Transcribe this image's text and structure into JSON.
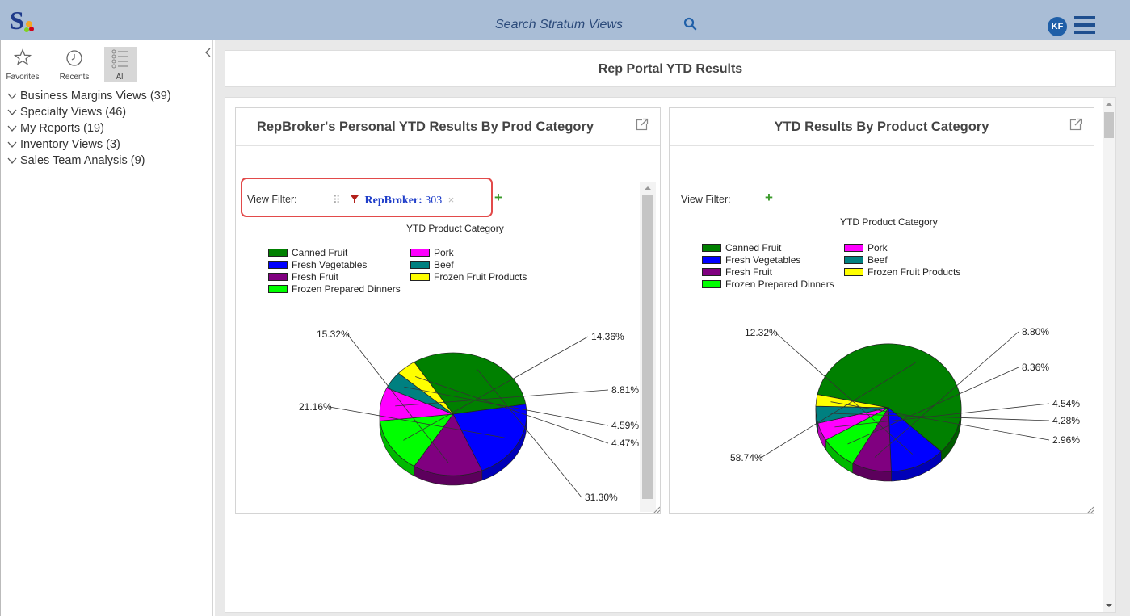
{
  "search": {
    "placeholder": "Search Stratum Views"
  },
  "user": {
    "initials": "KF"
  },
  "sidebar": {
    "nav": [
      {
        "label": "Favorites",
        "icon": "star-icon"
      },
      {
        "label": "Recents",
        "icon": "clock-icon"
      },
      {
        "label": "All",
        "icon": "list-icon"
      }
    ],
    "tree": [
      {
        "label": "Business Margins Views (39)"
      },
      {
        "label": "Specialty Views (46)"
      },
      {
        "label": "My Reports (19)"
      },
      {
        "label": "Inventory Views (3)"
      },
      {
        "label": "Sales Team Analysis (9)"
      }
    ]
  },
  "main": {
    "header_title": "Rep Portal YTD Results",
    "panels": [
      {
        "title": "RepBroker's Personal YTD Results By Prod Category",
        "filter_label": "View Filter:",
        "filter_key": "RepBroker:",
        "filter_value": "303",
        "chart_title": "YTD Product Category"
      },
      {
        "title": "YTD Results By Product Category",
        "filter_label": "View Filter:",
        "chart_title": "YTD Product Category"
      }
    ]
  },
  "colors": {
    "Canned Fruit": "#008000",
    "Fresh Vegetables": "#0000ff",
    "Fresh Fruit": "#800080",
    "Frozen Prepared Dinners": "#00ff00",
    "Pork": "#ff00ff",
    "Beef": "#008080",
    "Frozen Fruit Products": "#ffff00"
  },
  "chart_data": [
    {
      "type": "pie",
      "title": "YTD Product Category",
      "categories": [
        "Canned Fruit",
        "Fresh Vegetables",
        "Fresh Fruit",
        "Frozen Prepared Dinners",
        "Pork",
        "Beef",
        "Frozen Fruit Products"
      ],
      "values": [
        31.3,
        21.16,
        15.32,
        14.36,
        8.81,
        4.59,
        4.47
      ],
      "labels": [
        "31.30%",
        "21.16%",
        "15.32%",
        "14.36%",
        "8.81%",
        "4.59%",
        "4.47%"
      ],
      "legend": "top"
    },
    {
      "type": "pie",
      "title": "YTD Product Category",
      "categories": [
        "Canned Fruit",
        "Fresh Vegetables",
        "Fresh Fruit",
        "Frozen Prepared Dinners",
        "Pork",
        "Beef",
        "Frozen Fruit Products"
      ],
      "values": [
        58.74,
        12.32,
        8.8,
        8.36,
        4.54,
        4.28,
        2.96
      ],
      "labels": [
        "58.74%",
        "12.32%",
        "8.80%",
        "8.36%",
        "4.54%",
        "4.28%",
        "2.96%"
      ],
      "legend": "top"
    }
  ]
}
